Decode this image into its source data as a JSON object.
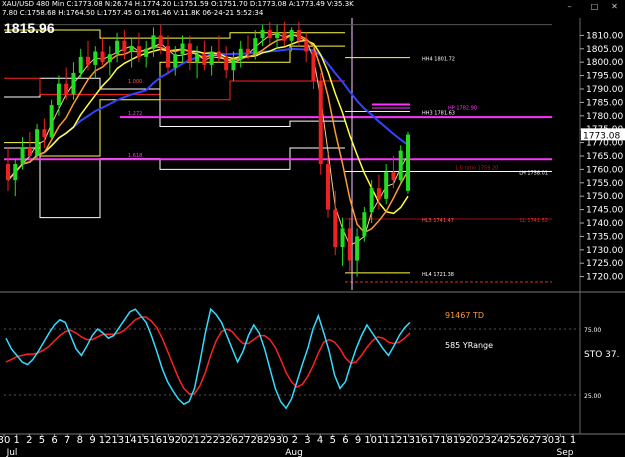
{
  "header": {
    "line1": "XAU/USD 480 Min  C:1773.08  N:26.74  H:1774.20  L:1751.59  O:1751.70  D:1773.08  A:1773.49  V:35.3K",
    "line2": "7.80  C:1758.68  H:1764.50  L:1757.45  O:1761.46  V:11.8K  06-24-21  5:52:34"
  },
  "top_left_price": "1815.96",
  "current_price_label": "1773.08",
  "price_axis": {
    "ticks": [
      "1810.00",
      "1805.00",
      "1800.00",
      "1795.00",
      "1790.00",
      "1785.00",
      "1780.00",
      "1775.00",
      "1770.00",
      "1765.00",
      "1760.00",
      "1755.00",
      "1750.00",
      "1745.00",
      "1740.00",
      "1735.00",
      "1730.00",
      "1725.00",
      "1720.00"
    ]
  },
  "indicator_axis": {
    "ticks": [
      "25.00",
      "75.00"
    ]
  },
  "sto_label": "STO  37.",
  "date_axis": {
    "labels": [
      "30",
      "1",
      "2",
      "5",
      "6",
      "7",
      "8",
      "9",
      "12",
      "13",
      "14",
      "15",
      "16",
      "19",
      "20",
      "21",
      "22",
      "23",
      "26",
      "27",
      "28",
      "29",
      "30",
      "2",
      "3",
      "4",
      "5",
      "6",
      "9",
      "10",
      "11",
      "12",
      "13",
      "16",
      "17",
      "18",
      "19",
      "20",
      "23",
      "24",
      "25",
      "26",
      "27",
      "30",
      "31",
      "1"
    ],
    "months": [
      "Jul",
      "Aug",
      "Sep"
    ]
  },
  "annotations": {
    "hh4": "HH4  1801.72",
    "hp": "HP  1782.90",
    "hh3": "HH3  1781.63",
    "fib_1272": "1.272",
    "fib_1618": "1.618",
    "fib_1000": "1.000",
    "hl3": "HL3  1741.47",
    "hl4": "HL4  1721.38",
    "lh": "LH  1758.01",
    "ll": "LL  1741.52",
    "mid": "1.0 ratio  1759.20",
    "td": "91467 TD",
    "yrange": "585 YRange"
  },
  "colors": {
    "bull": "#22dd22",
    "bear": "#ee2222",
    "magenta": "#ff33ff",
    "yellow": "#ffff44",
    "blue_ma": "#3344ff",
    "orange": "#ff9933",
    "white": "#ffffff",
    "cyan": "#33ddff",
    "red": "#ff2222",
    "grid_gray": "#888888",
    "dark_red": "#991111"
  },
  "chart_data": [
    {
      "type": "candlestick",
      "title": "XAU/USD 480 Min",
      "ylim": [
        1715,
        1815
      ],
      "ohlc": [
        [
          1762,
          1768,
          1752,
          1756
        ],
        [
          1756,
          1764,
          1750,
          1762
        ],
        [
          1762,
          1772,
          1760,
          1768
        ],
        [
          1768,
          1774,
          1763,
          1765
        ],
        [
          1765,
          1777,
          1764,
          1775
        ],
        [
          1775,
          1779,
          1768,
          1772
        ],
        [
          1772,
          1786,
          1771,
          1784
        ],
        [
          1784,
          1795,
          1780,
          1792
        ],
        [
          1792,
          1798,
          1786,
          1788
        ],
        [
          1788,
          1800,
          1786,
          1796
        ],
        [
          1796,
          1805,
          1794,
          1802
        ],
        [
          1802,
          1808,
          1797,
          1799
        ],
        [
          1799,
          1806,
          1794,
          1804
        ],
        [
          1804,
          1809,
          1799,
          1800
        ],
        [
          1800,
          1806,
          1795,
          1803
        ],
        [
          1803,
          1811,
          1800,
          1808
        ],
        [
          1808,
          1812,
          1801,
          1804
        ],
        [
          1804,
          1809,
          1798,
          1806
        ],
        [
          1806,
          1811,
          1800,
          1802
        ],
        [
          1802,
          1808,
          1798,
          1805
        ],
        [
          1805,
          1813,
          1802,
          1810
        ],
        [
          1810,
          1814,
          1803,
          1806
        ],
        [
          1806,
          1810,
          1796,
          1798
        ],
        [
          1798,
          1806,
          1795,
          1803
        ],
        [
          1803,
          1810,
          1800,
          1807
        ],
        [
          1807,
          1810,
          1797,
          1800
        ],
        [
          1800,
          1806,
          1794,
          1803
        ],
        [
          1803,
          1808,
          1797,
          1799
        ],
        [
          1799,
          1806,
          1795,
          1804
        ],
        [
          1804,
          1810,
          1800,
          1802
        ],
        [
          1802,
          1806,
          1794,
          1797
        ],
        [
          1797,
          1804,
          1793,
          1801
        ],
        [
          1801,
          1808,
          1798,
          1805
        ],
        [
          1805,
          1810,
          1801,
          1803
        ],
        [
          1803,
          1812,
          1801,
          1809
        ],
        [
          1809,
          1814,
          1806,
          1812
        ],
        [
          1812,
          1815,
          1807,
          1809
        ],
        [
          1809,
          1814,
          1805,
          1811
        ],
        [
          1811,
          1815,
          1806,
          1808
        ],
        [
          1808,
          1813,
          1804,
          1812
        ],
        [
          1812,
          1815,
          1806,
          1808
        ],
        [
          1808,
          1811,
          1800,
          1804
        ],
        [
          1804,
          1806,
          1790,
          1793
        ],
        [
          1793,
          1796,
          1758,
          1762
        ],
        [
          1762,
          1766,
          1742,
          1745
        ],
        [
          1745,
          1752,
          1728,
          1731
        ],
        [
          1731,
          1742,
          1724,
          1738
        ],
        [
          1738,
          1742,
          1722,
          1726
        ],
        [
          1726,
          1738,
          1720,
          1735
        ],
        [
          1735,
          1746,
          1733,
          1744
        ],
        [
          1744,
          1756,
          1740,
          1753
        ],
        [
          1753,
          1758,
          1745,
          1749
        ],
        [
          1749,
          1762,
          1747,
          1759
        ],
        [
          1759,
          1765,
          1753,
          1756
        ],
        [
          1756,
          1769,
          1755,
          1767
        ],
        [
          1752,
          1774,
          1751,
          1773
        ]
      ]
    },
    {
      "type": "line",
      "title": "STO",
      "ylim": [
        0,
        100
      ],
      "series": [
        {
          "values": [
            68,
            60,
            55,
            50,
            48,
            52,
            58,
            65,
            72,
            78,
            82,
            80,
            70,
            60,
            55,
            62,
            70,
            75,
            72,
            68,
            70,
            76,
            82,
            88,
            90,
            85,
            80,
            70,
            58,
            45,
            35,
            28,
            22,
            18,
            20,
            30,
            50,
            72,
            90,
            86,
            80,
            70,
            60,
            50,
            58,
            70,
            78,
            72,
            60,
            45,
            30,
            20,
            15,
            22,
            35,
            48,
            60,
            75,
            85,
            72,
            58,
            40,
            30,
            35,
            48,
            60,
            70,
            78,
            72,
            66,
            60,
            55,
            62,
            70,
            76,
            80
          ]
        },
        {
          "values": [
            50,
            52,
            54,
            55,
            56,
            56,
            57,
            59,
            62,
            66,
            70,
            73,
            74,
            72,
            69,
            67,
            67,
            69,
            71,
            71,
            71,
            72,
            74,
            78,
            82,
            84,
            84,
            81,
            76,
            68,
            58,
            48,
            38,
            30,
            26,
            26,
            32,
            42,
            55,
            66,
            73,
            75,
            73,
            68,
            64,
            64,
            67,
            70,
            70,
            67,
            61,
            52,
            42,
            35,
            31,
            33,
            39,
            47,
            57,
            65,
            67,
            65,
            60,
            53,
            49,
            50,
            55,
            61,
            66,
            69,
            68,
            65,
            64,
            65,
            68,
            72
          ]
        }
      ]
    }
  ]
}
